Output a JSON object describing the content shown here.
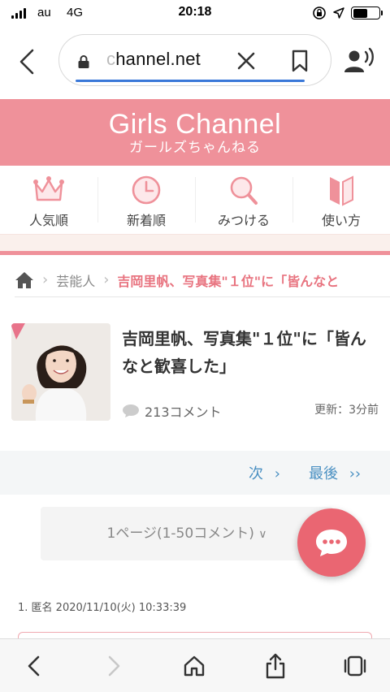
{
  "status_bar": {
    "carrier": "au",
    "network": "4G",
    "time": "20:18",
    "battery_level": 0.55
  },
  "browser": {
    "url_faded": "c",
    "url_text": "hannel.net",
    "icons": [
      "back-icon",
      "lock-icon",
      "clear-icon",
      "bookmark-icon",
      "voice-icon"
    ]
  },
  "site": {
    "logo": "Girls Channel",
    "logo_sub": "ガールズちゃんねる",
    "brand_color": "#ef919a"
  },
  "nav": {
    "tabs": [
      {
        "label": "人気順",
        "icon": "crown-icon"
      },
      {
        "label": "新着順",
        "icon": "clock-icon"
      },
      {
        "label": "みつける",
        "icon": "search-icon"
      },
      {
        "label": "使い方",
        "icon": "book-icon"
      }
    ]
  },
  "breadcrumb": {
    "category": "芸能人",
    "current": "吉岡里帆、写真集\"１位\"に「皆んなと"
  },
  "topic": {
    "title": "吉岡里帆、写真集\"１位\"に「皆んなと歓喜した」",
    "comment_count": "213コメント",
    "updated": "更新：3分前"
  },
  "pager": {
    "next": "次",
    "last": "最後"
  },
  "page_select": {
    "value": "1ページ(1-50コメント)"
  },
  "comment": {
    "meta": "1. 匿名 2020/11/10(火) 10:33:39"
  }
}
